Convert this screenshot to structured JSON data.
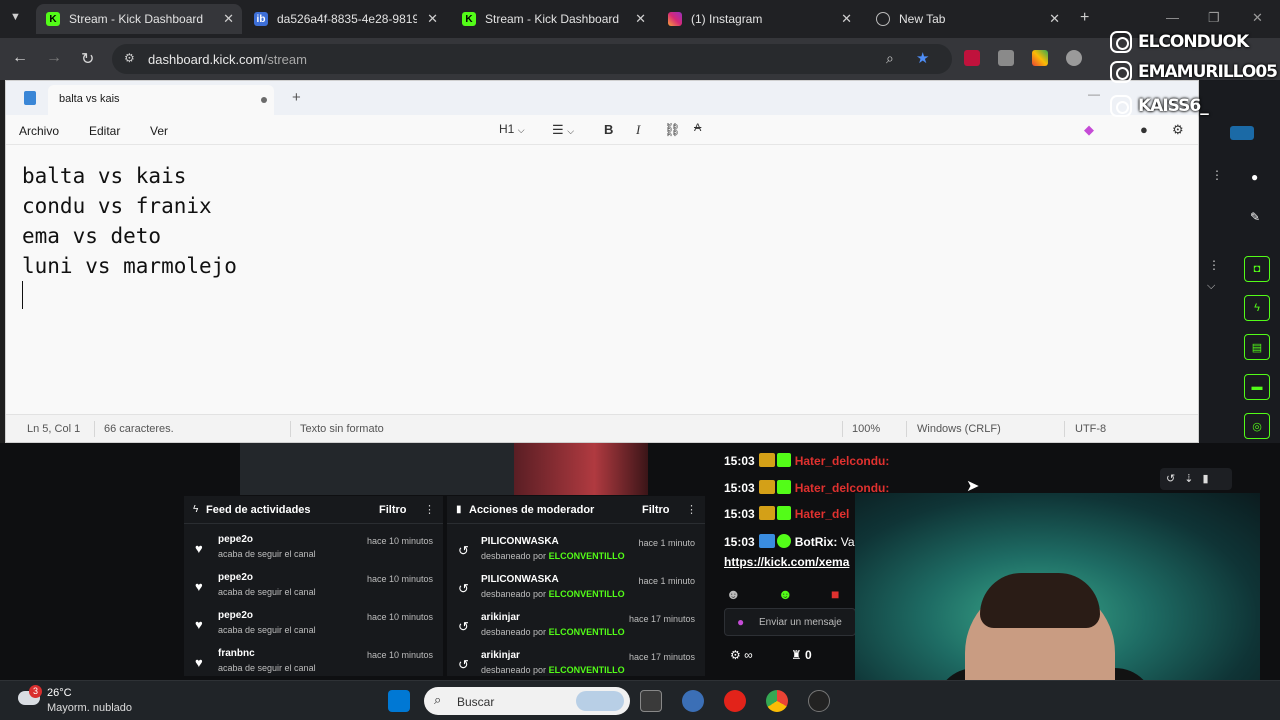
{
  "browser": {
    "tabs": [
      {
        "label": "Stream - Kick Dashboard",
        "active": true
      },
      {
        "label": "da526a4f-8835-4e28-9819-",
        "active": false
      },
      {
        "label": "Stream - Kick Dashboard",
        "active": false
      },
      {
        "label": "(1) Instagram",
        "active": false
      },
      {
        "label": "New Tab",
        "active": false
      }
    ],
    "url_host": "dashboard.kick.com",
    "url_path": "/stream"
  },
  "notepad": {
    "tab_title": "balta vs kais",
    "menu": [
      "Archivo",
      "Editar",
      "Ver"
    ],
    "heading_tool": "H1",
    "lines": [
      "balta vs kais",
      "condu vs franix",
      "ema vs deto",
      "luni vs marmolejo"
    ],
    "status": {
      "position": "Ln 5, Col 1",
      "chars": "66 caracteres.",
      "format": "Texto sin formato",
      "zoom": "100%",
      "eol": "Windows (CRLF)",
      "encoding": "UTF-8"
    }
  },
  "instagram_overlay": [
    "ELCONDUOK",
    "EMAMURILLO05",
    "KAISS6_"
  ],
  "activity_feed": {
    "title": "Feed de actividades",
    "filter": "Filtro",
    "items": [
      {
        "name": "pepe2o",
        "sub": "acaba de seguir el canal",
        "time": "hace 10 minutos"
      },
      {
        "name": "pepe2o",
        "sub": "acaba de seguir el canal",
        "time": "hace 10 minutos"
      },
      {
        "name": "pepe2o",
        "sub": "acaba de seguir el canal",
        "time": "hace 10 minutos"
      },
      {
        "name": "franbnc",
        "sub": "acaba de seguir el canal",
        "time": "hace 10 minutos"
      }
    ]
  },
  "mod_actions": {
    "title": "Acciones de moderador",
    "filter": "Filtro",
    "by_label": "desbaneado por",
    "moderator": "ELCONVENTILLO",
    "items": [
      {
        "name": "PILICONWASKA",
        "time": "hace 1 minuto"
      },
      {
        "name": "PILICONWASKA",
        "time": "hace 1 minuto"
      },
      {
        "name": "arikinjar",
        "time": "hace 17 minutos"
      },
      {
        "name": "arikinjar",
        "time": "hace 17 minutos"
      }
    ]
  },
  "chat": {
    "lines": [
      {
        "time": "15:03",
        "user": "Hater_delcondu:"
      },
      {
        "time": "15:03",
        "user": "Hater_delcondu:"
      },
      {
        "time": "15:03",
        "user": "Hater_del"
      },
      {
        "time": "15:03",
        "user": "BotRix:",
        "text": "Va"
      }
    ],
    "link": "https://kick.com/xema",
    "input_placeholder": "Enviar un mensaje",
    "viewer_count": "0"
  },
  "taskbar": {
    "temperature": "26°C",
    "weather": "Mayorm. nublado",
    "notification_count": "3",
    "search_label": "Buscar"
  },
  "colors": {
    "kick_green": "#53fc18",
    "chat_red": "#e0312f"
  }
}
